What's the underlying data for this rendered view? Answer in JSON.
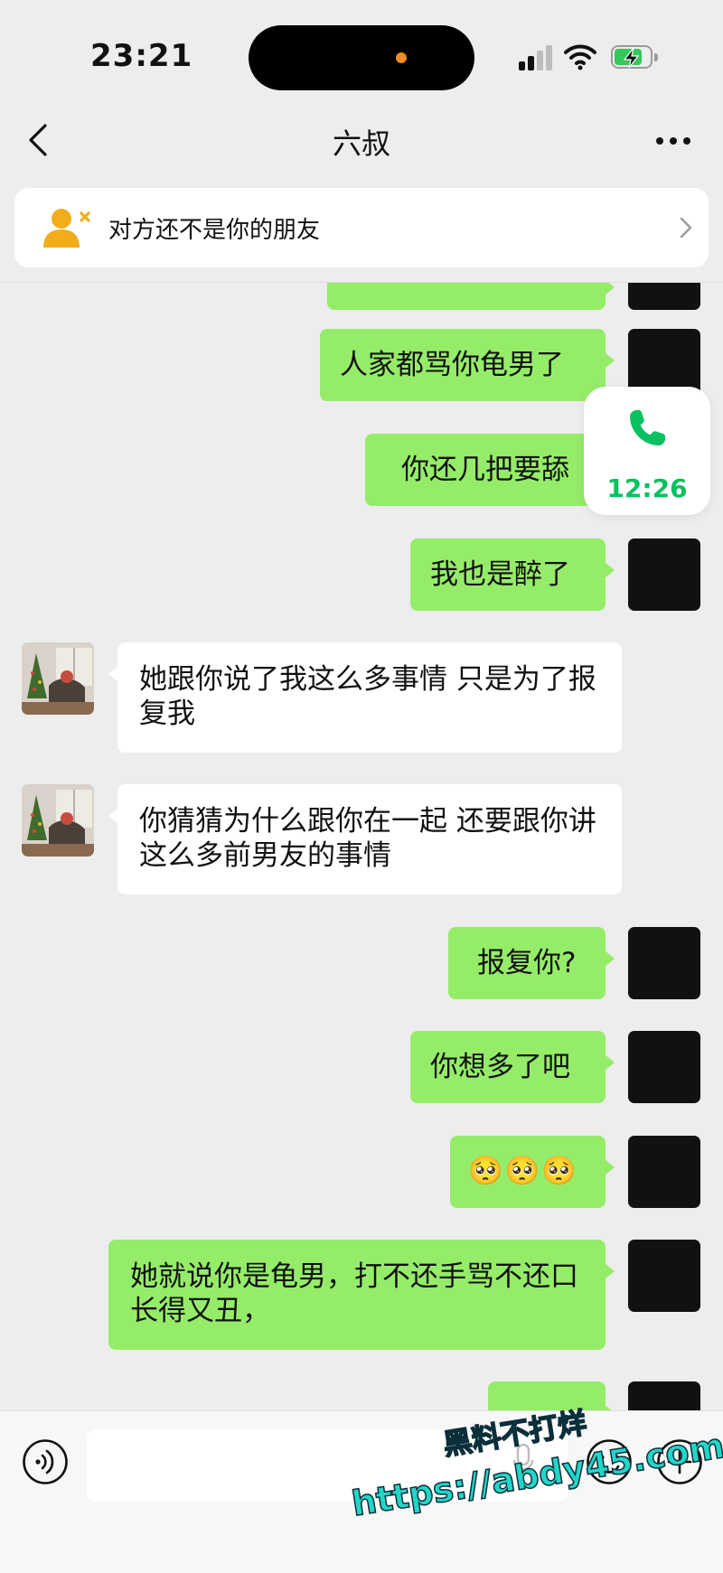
{
  "status_bar": {
    "time": "23:21"
  },
  "header": {
    "title": "六叔"
  },
  "banner": {
    "text": "对方还不是你的朋友"
  },
  "floating_call": {
    "duration": "12:26"
  },
  "messages": [
    {
      "side": "out",
      "text": ""
    },
    {
      "side": "out",
      "text": "人家都骂你龟男了"
    },
    {
      "side": "out",
      "text": "你还几把要舔"
    },
    {
      "side": "out",
      "text": "我也是醉了"
    },
    {
      "side": "in",
      "text": "她跟你说了我这么多事情 只是为了报复我"
    },
    {
      "side": "in",
      "text": "你猜猜为什么跟你在一起 还要跟你讲这么多前男友的事情"
    },
    {
      "side": "out",
      "text": "报复你?"
    },
    {
      "side": "out",
      "text": "你想多了吧"
    },
    {
      "side": "out",
      "text": "🥺🥺🥺"
    },
    {
      "side": "out",
      "text": "她就说你是龟男，打不还手骂不还口长得又丑，"
    },
    {
      "side": "out",
      "text": ""
    }
  ],
  "watermark": {
    "line1": "黑料不打烊",
    "line2": "https://abdy45.com"
  },
  "colors": {
    "bubble_out": "#95ec69",
    "bubble_in": "#ffffff",
    "call_green": "#07c160",
    "background": "#ededed"
  },
  "icons": [
    "back-chevron-icon",
    "more-dots-icon",
    "stranger-user-icon",
    "chevron-right-icon",
    "phone-icon",
    "voice-icon",
    "mic-icon",
    "emoji-icon",
    "plus-icon"
  ]
}
